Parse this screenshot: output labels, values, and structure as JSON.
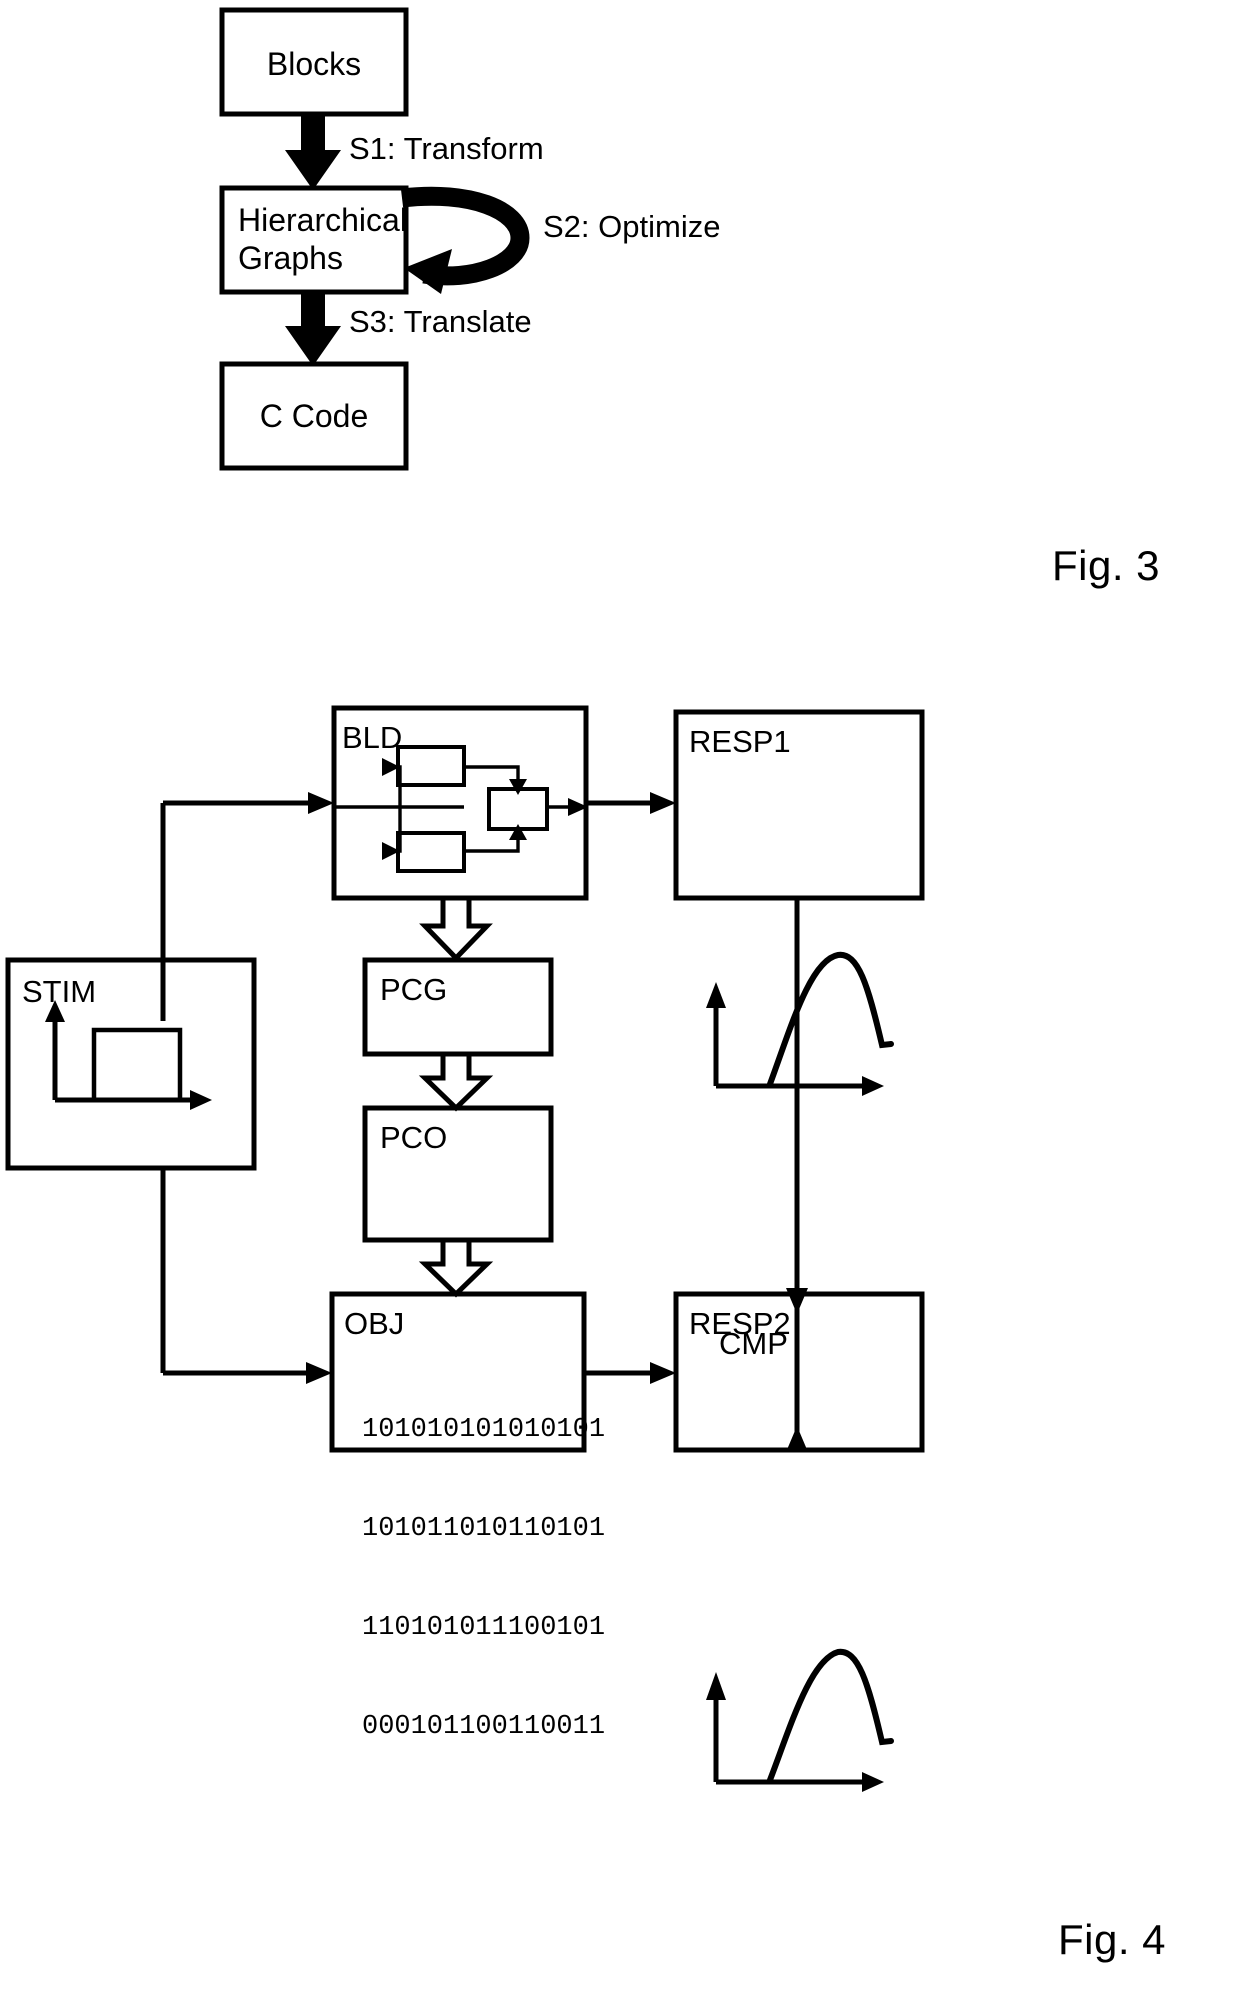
{
  "document": {
    "type": "patent-figure-sheet",
    "figures": [
      "Fig. 3",
      "Fig. 4"
    ]
  },
  "figure3": {
    "caption": "Fig. 3",
    "nodes": [
      {
        "id": "blocks",
        "label": "Blocks"
      },
      {
        "id": "hierarchical_graphs",
        "label": "Hierarchical\nGraphs",
        "line1": "Hierarchical",
        "line2": "Graphs"
      },
      {
        "id": "c_code",
        "label": "C Code"
      }
    ],
    "edges": [
      {
        "id": "s1",
        "label": "S1: Transform",
        "from": "blocks",
        "to": "hierarchical_graphs",
        "style": "block-arrow-down"
      },
      {
        "id": "s2",
        "label": "S2: Optimize",
        "from": "hierarchical_graphs",
        "to": "hierarchical_graphs",
        "style": "curved-self-loop"
      },
      {
        "id": "s3",
        "label": "S3: Translate",
        "from": "hierarchical_graphs",
        "to": "c_code",
        "style": "block-arrow-down"
      }
    ]
  },
  "figure4": {
    "caption": "Fig. 4",
    "nodes": [
      {
        "id": "stim",
        "label": "STIM",
        "content": "step-waveform"
      },
      {
        "id": "bld",
        "label": "BLD",
        "content": "block-diagram"
      },
      {
        "id": "resp1",
        "label": "RESP1",
        "content": "hump-waveform"
      },
      {
        "id": "pcg",
        "label": "PCG",
        "content": ""
      },
      {
        "id": "pco",
        "label": "PCO",
        "content": ""
      },
      {
        "id": "obj",
        "label": "OBJ",
        "content": "binary-listing",
        "bits": [
          "101010101010101",
          "101011010110101",
          "110101011100101",
          "000101100110011"
        ]
      },
      {
        "id": "resp2",
        "label": "RESP2",
        "content": "hump-waveform"
      },
      {
        "id": "cmp",
        "label": "CMP",
        "content": ""
      }
    ],
    "edges": [
      {
        "from": "stim",
        "to": "bld",
        "style": "thin-arrow"
      },
      {
        "from": "stim",
        "to": "obj",
        "style": "thin-arrow"
      },
      {
        "from": "bld",
        "to": "resp1",
        "style": "thin-arrow"
      },
      {
        "from": "bld",
        "to": "pcg",
        "style": "hollow-arrow"
      },
      {
        "from": "pcg",
        "to": "pco",
        "style": "hollow-arrow"
      },
      {
        "from": "pco",
        "to": "obj",
        "style": "hollow-arrow"
      },
      {
        "from": "obj",
        "to": "resp2",
        "style": "thin-arrow"
      },
      {
        "from": "resp1",
        "to": "cmp",
        "style": "thin-arrow"
      },
      {
        "from": "resp2",
        "to": "cmp",
        "style": "thin-arrow"
      }
    ]
  }
}
